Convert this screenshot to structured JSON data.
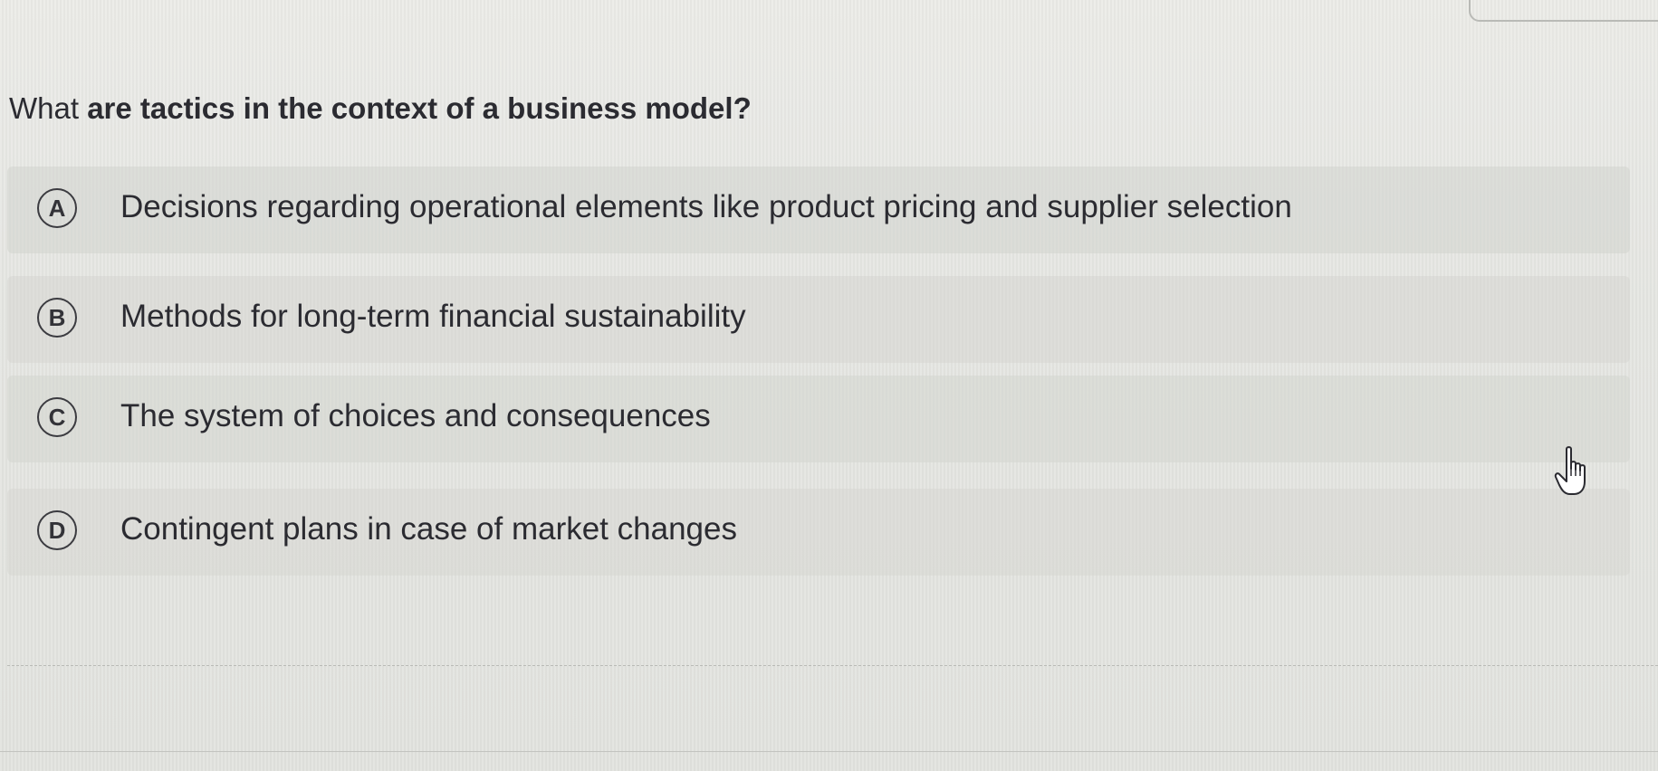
{
  "question": {
    "prefix": "What ",
    "bold": "are tactics in the context of a business model?"
  },
  "options": [
    {
      "letter": "A",
      "text": "Decisions regarding operational elements like product pricing and supplier selection"
    },
    {
      "letter": "B",
      "text": "Methods for long-term financial sustainability"
    },
    {
      "letter": "C",
      "text": "The system of choices and consequences"
    },
    {
      "letter": "D",
      "text": "Contingent plans in case of market changes"
    }
  ],
  "cursor": {
    "icon": "hand-pointer-icon"
  },
  "colors": {
    "background": "#e4e5e1",
    "text": "#2b2b31",
    "circle_border": "#3b3b40"
  }
}
